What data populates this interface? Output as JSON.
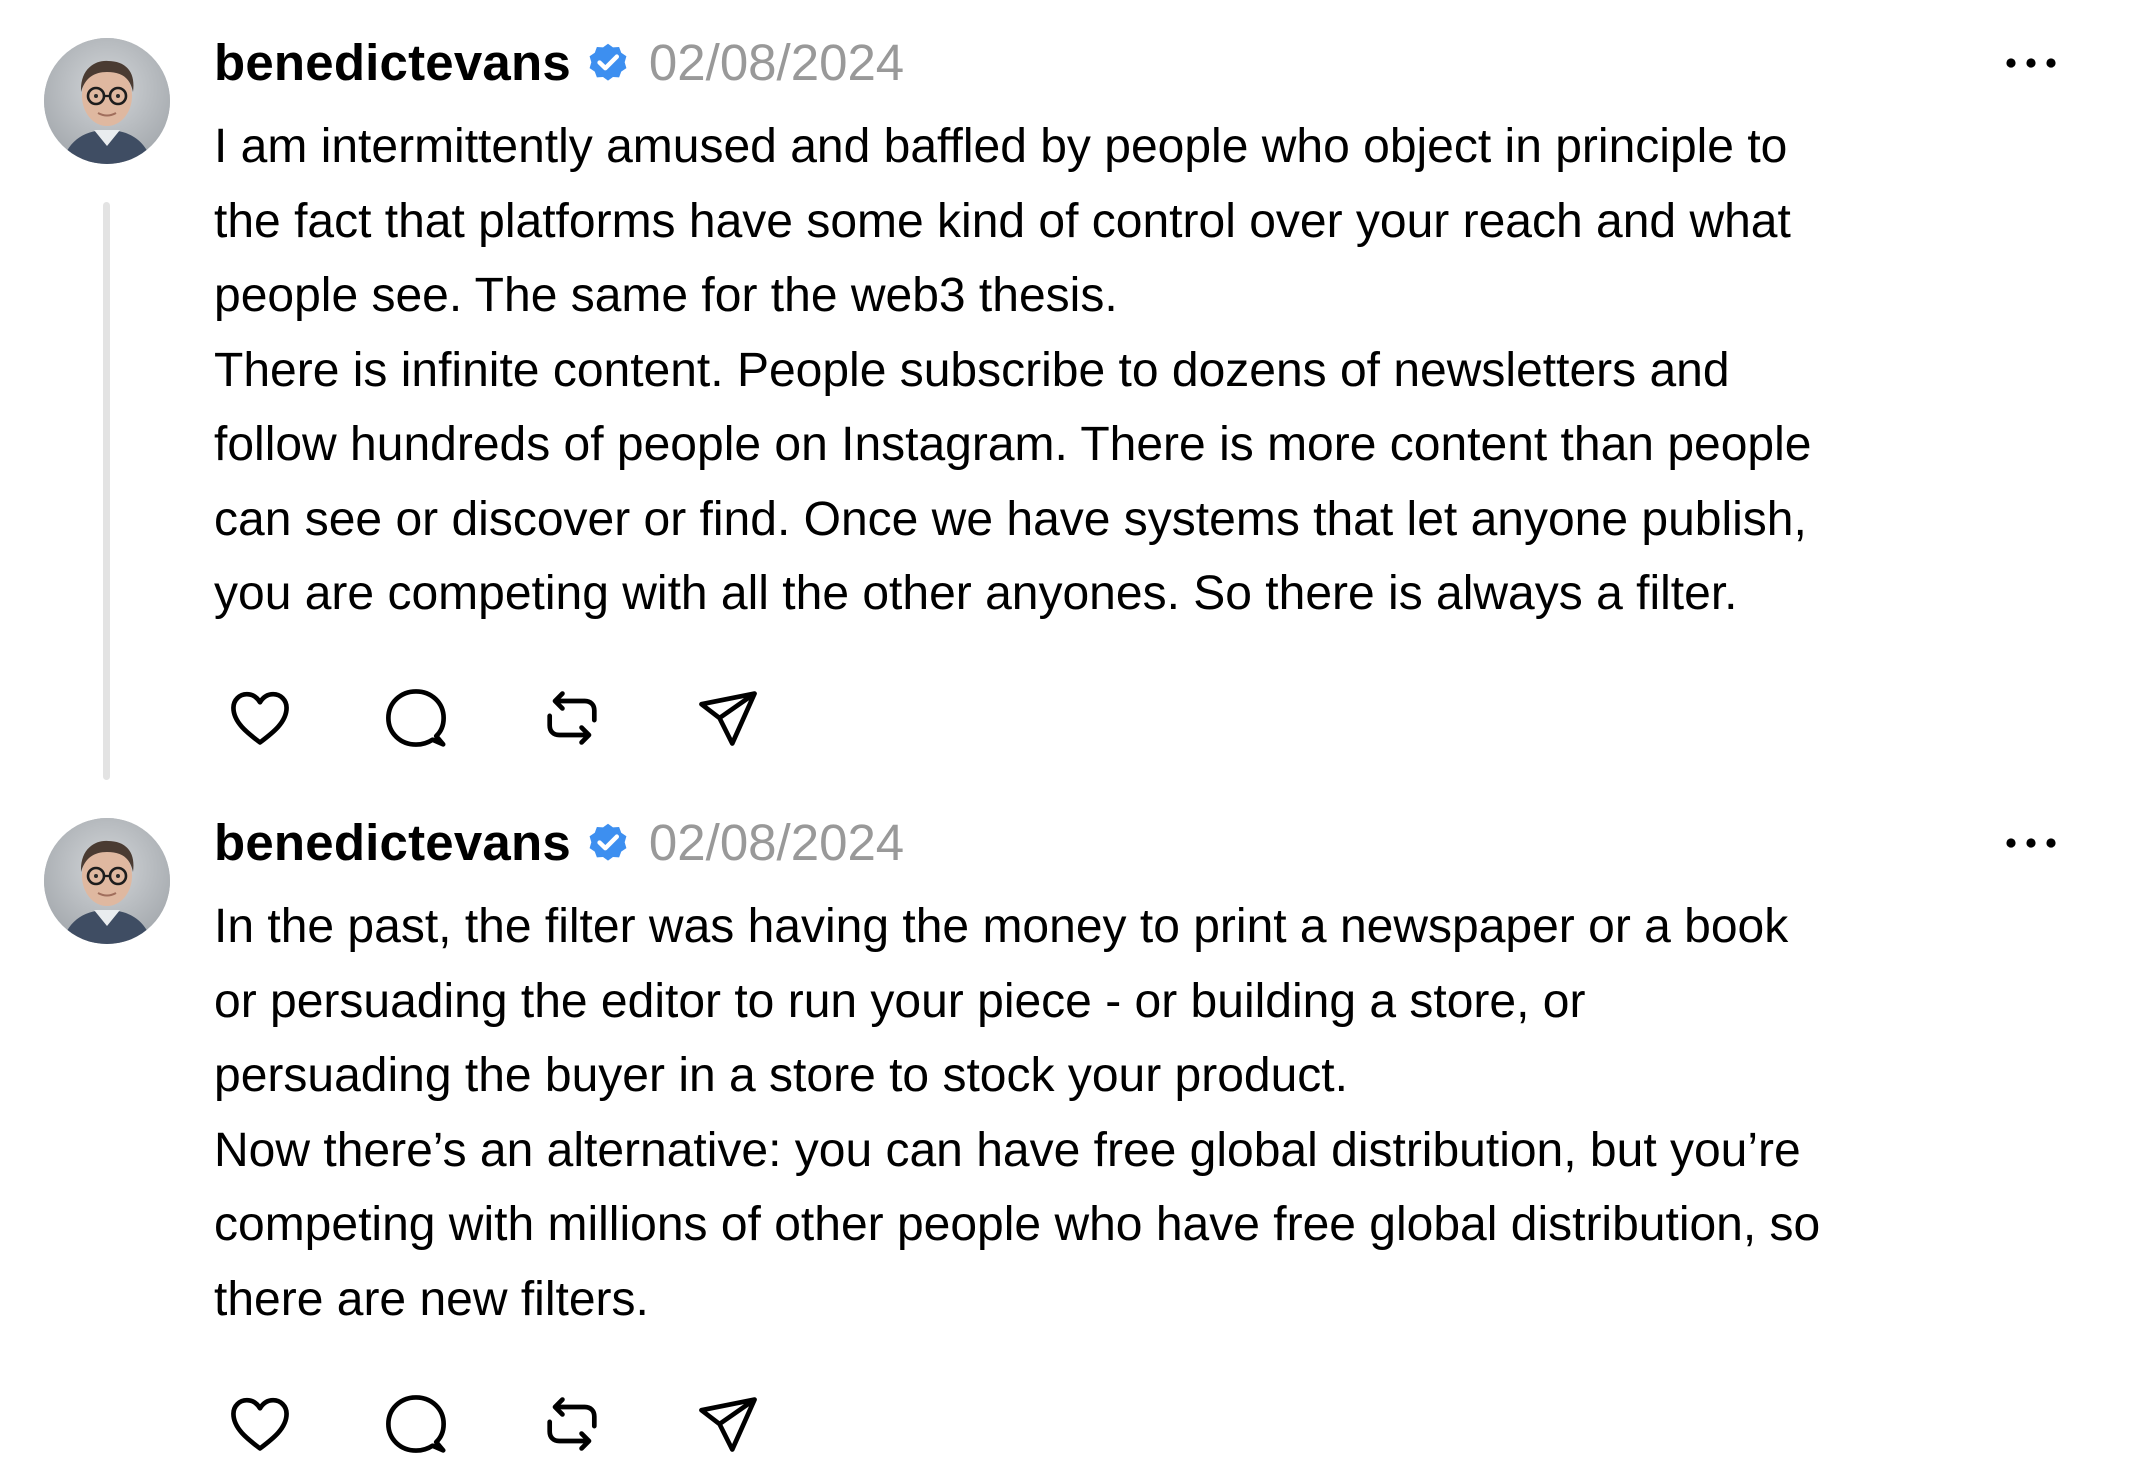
{
  "posts": [
    {
      "username": "benedictevans",
      "verified_icon": "verified-badge-icon",
      "date": "02/08/2024",
      "more_icon": "more-options-icon",
      "lines": [
        "I am intermittently amused and baffled by people who object in principle to",
        "the fact that platforms have some kind of control over your reach and what",
        "people see. The same for the web3 thesis.",
        "There is infinite content. People subscribe to dozens of newsletters and",
        "follow hundreds of people on Instagram. There is more content than people",
        "can see or discover or find. Once we have systems that let anyone publish,",
        "you are competing with all the other anyones. So there is always a filter."
      ],
      "actions": [
        "like-icon",
        "reply-icon",
        "repost-icon",
        "share-icon"
      ]
    },
    {
      "username": "benedictevans",
      "verified_icon": "verified-badge-icon",
      "date": "02/08/2024",
      "more_icon": "more-options-icon",
      "lines": [
        "In the past, the filter was having the money to print a newspaper or a book",
        "or persuading the editor to run your piece - or building a store, or",
        "persuading the buyer in a store to stock your product.",
        "Now there’s an alternative: you can have free global distribution, but you’re",
        "competing with millions of other people who have free global distribution, so",
        "there are new filters."
      ],
      "actions": [
        "like-icon",
        "reply-icon",
        "repost-icon",
        "share-icon"
      ]
    }
  ],
  "colors": {
    "text": "#000000",
    "date": "#999999",
    "verified": "#3d8ff0",
    "thread_line": "#e3e3e3",
    "icon": "#000000"
  }
}
